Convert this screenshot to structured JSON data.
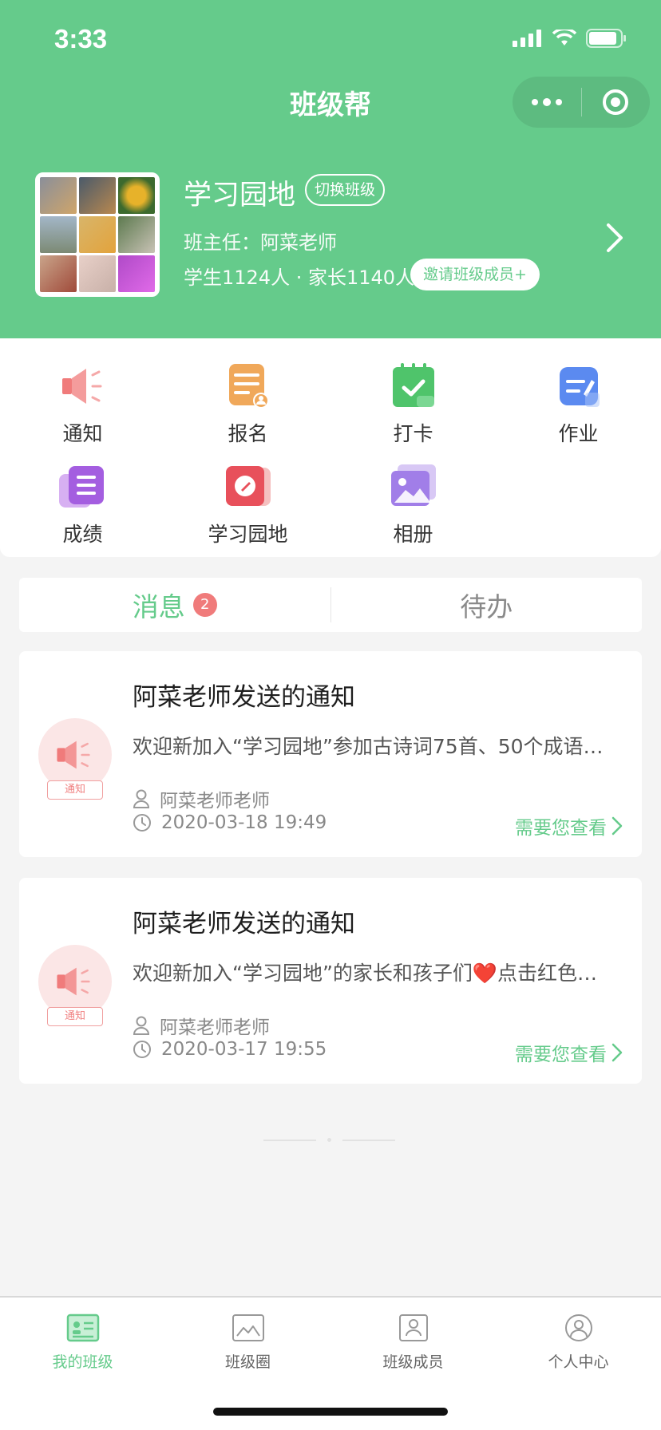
{
  "status_bar": {
    "time": "3:33"
  },
  "app": {
    "title": "班级帮"
  },
  "class_info": {
    "name": "学习园地",
    "switch_label": "切换班级",
    "teacher": "班主任：阿菜老师",
    "counts": "学生1124人 · 家长1140人",
    "invite_label": "邀请班级成员+"
  },
  "features": [
    {
      "label": "通知",
      "icon": "megaphone-icon"
    },
    {
      "label": "报名",
      "icon": "signup-icon"
    },
    {
      "label": "打卡",
      "icon": "checkin-icon"
    },
    {
      "label": "作业",
      "icon": "homework-icon"
    },
    {
      "label": "成绩",
      "icon": "grades-icon"
    },
    {
      "label": "学习园地",
      "icon": "study-icon"
    },
    {
      "label": "相册",
      "icon": "album-icon"
    }
  ],
  "tabs": {
    "messages_label": "消息",
    "messages_badge": "2",
    "todo_label": "待办"
  },
  "messages": [
    {
      "title": "阿菜老师发送的通知",
      "body": "欢迎新加入“学习园地”参加古诗词75首、50个成语…",
      "tag": "通知",
      "author": "阿菜老师老师",
      "time": "2020-03-18 19:49",
      "action": "需要您查看"
    },
    {
      "title": "阿菜老师发送的通知",
      "body": "欢迎新加入“学习园地”的家长和孩子们❤️点击红色…",
      "tag": "通知",
      "author": "阿菜老师老师",
      "time": "2020-03-17 19:55",
      "action": "需要您查看"
    }
  ],
  "tabbar": [
    {
      "label": "我的班级",
      "active": true
    },
    {
      "label": "班级圈",
      "active": false
    },
    {
      "label": "班级成员",
      "active": false
    },
    {
      "label": "个人中心",
      "active": false
    }
  ],
  "colors": {
    "primary": "#65cb8b",
    "badge": "#f07b7b",
    "notice": "#f08080"
  }
}
